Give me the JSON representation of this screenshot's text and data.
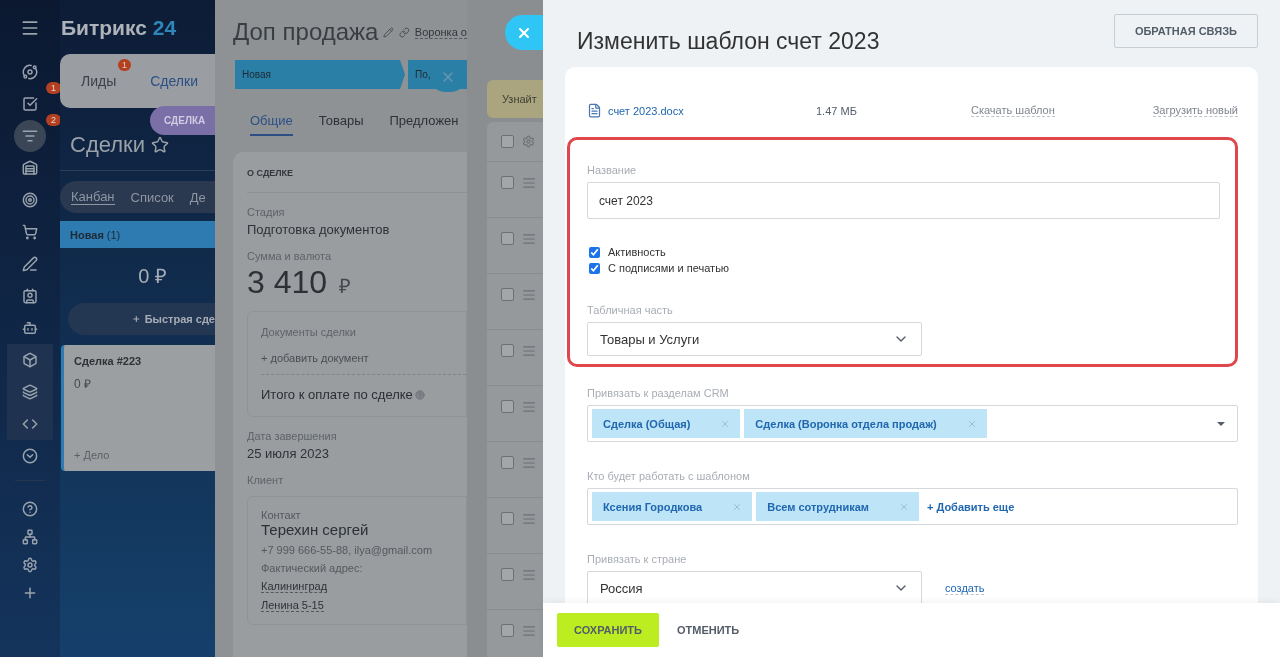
{
  "sidebar": {
    "items": [
      {
        "kind": "orbit",
        "selected": false,
        "pinned": false
      },
      {
        "kind": "tasks",
        "badge": "1",
        "selected": false,
        "pinned": false
      },
      {
        "kind": "funnel",
        "badge": "2",
        "selected": true,
        "pinned": false
      },
      {
        "kind": "warehouse",
        "selected": false,
        "pinned": false
      },
      {
        "kind": "target",
        "selected": false,
        "pinned": false
      },
      {
        "kind": "cart",
        "selected": false,
        "pinned": false
      },
      {
        "kind": "sign",
        "selected": false,
        "pinned": false
      },
      {
        "kind": "contact",
        "selected": false,
        "pinned": false
      },
      {
        "kind": "robot",
        "selected": false,
        "pinned": false
      },
      {
        "kind": "box",
        "selected": false,
        "pinned": true
      },
      {
        "kind": "market",
        "selected": false,
        "pinned": true
      },
      {
        "kind": "code",
        "selected": false,
        "pinned": true
      },
      {
        "kind": "more",
        "selected": false,
        "pinned": false
      }
    ],
    "bottom": [
      {
        "kind": "help"
      },
      {
        "kind": "network"
      },
      {
        "kind": "settings"
      },
      {
        "kind": "plus"
      }
    ]
  },
  "crm": {
    "logo": {
      "name": "Битрикс",
      "number": "24"
    },
    "top_tabs": [
      {
        "label": "Лиды",
        "badge": "1",
        "selected": false
      },
      {
        "label": "Сделки",
        "selected": true
      }
    ],
    "entity_pill": "СДЕЛКА",
    "title": "Сделки",
    "view_tabs": [
      {
        "label": "Канбан",
        "selected": true
      },
      {
        "label": "Список",
        "selected": false
      },
      {
        "label": "Де",
        "selected": false
      }
    ],
    "column": {
      "name": "Новая",
      "count": "(1)",
      "sum": "0 ₽",
      "quick_add": "Быстрая сде"
    },
    "card": {
      "title": "Сделка #223",
      "sum": "0 ₽",
      "action": "+ Дело"
    }
  },
  "deal": {
    "title": "Доп продажа",
    "funnel": "Воронка о",
    "stages": [
      {
        "label": "Новая"
      },
      {
        "label": "По,"
      }
    ],
    "tabs": [
      {
        "label": "Общие",
        "selected": true
      },
      {
        "label": "Товары",
        "selected": false
      },
      {
        "label": "Предложен",
        "selected": false
      }
    ],
    "section": "О СДЕЛКЕ",
    "stage_label": "Стадия",
    "stage_value": "Подготовка документов",
    "amount_label": "Сумма и валюта",
    "amount": "3 410",
    "currency": "₽",
    "docs_label": "Документы сделки",
    "docs_add": "+ добавить документ",
    "total_label": "Итого к оплате по сделке",
    "date_label": "Дата завершения",
    "date_value": "25 июля 2023",
    "client_label": "Клиент",
    "contact": {
      "label": "Контакт",
      "name": "Терехин сергей",
      "phones": "+7 999 666-55-88, ilya@gmail.com",
      "address_label": "Фактический адрес:",
      "address": [
        "Калининград",
        "Ленина 5-15"
      ]
    }
  },
  "list": {
    "banner": "Узнайт",
    "header": {
      "checked": false
    },
    "rows": [
      {
        "checked": false
      },
      {
        "checked": false
      },
      {
        "checked": false
      },
      {
        "checked": false
      },
      {
        "checked": false
      },
      {
        "checked": false
      },
      {
        "checked": false
      },
      {
        "checked": false
      },
      {
        "checked": false
      }
    ]
  },
  "template": {
    "title": "Изменить шаблон счет 2023",
    "feedback_button": "ОБРАТНАЯ СВЯЗЬ",
    "file": {
      "name": "счет 2023.docx",
      "size": "1.47 МБ",
      "download": "Скачать шаблон",
      "upload": "Загрузить новый"
    },
    "highlighted": true,
    "name_label": "Название",
    "name_value": "счет 2023",
    "checkboxes": [
      {
        "label": "Активность",
        "checked": true
      },
      {
        "label": "С подписями и печатью",
        "checked": true
      }
    ],
    "table_label": "Табличная часть",
    "table_value": "Товары и Услуги",
    "crm_label": "Привязать к разделам CRM",
    "crm_tags": [
      "Сделка (Общая)",
      "Сделка (Воронка отдела продаж)"
    ],
    "users_label": "Кто будет работать с шаблоном",
    "user_tags": [
      "Ксения Городкова",
      "Всем сотрудникам"
    ],
    "add_more": "+ Добавить еще",
    "country_label": "Привязать к стране",
    "country_value": "Россия",
    "create_link": "создать",
    "save": "СОХРАНИТЬ",
    "cancel": "ОТМЕНИТЬ"
  }
}
